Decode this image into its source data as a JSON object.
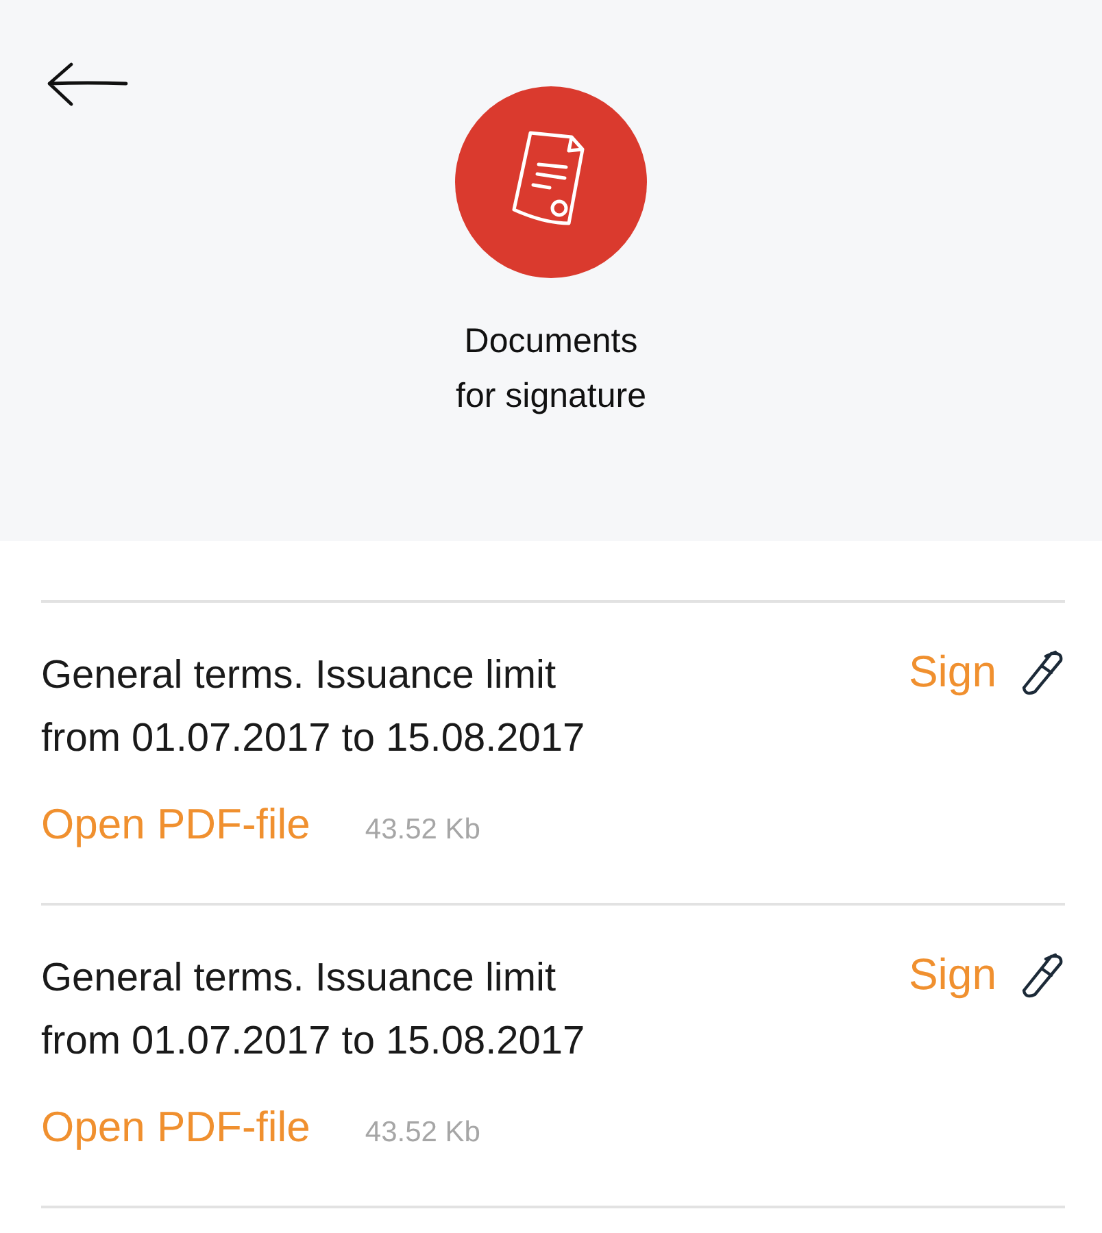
{
  "header": {
    "title_lines": [
      "Documents",
      "for signature"
    ]
  },
  "documents": [
    {
      "title_lines": [
        "General terms. Issuance limit",
        "from 01.07.2017 to 15.08.2017"
      ],
      "action": "Sign",
      "link": "Open PDF-file",
      "size": "43.52 Kb"
    },
    {
      "title_lines": [
        "General terms. Issuance limit",
        "from 01.07.2017 to 15.08.2017"
      ],
      "action": "Sign",
      "link": "Open PDF-file",
      "size": "43.52 Kb"
    }
  ]
}
